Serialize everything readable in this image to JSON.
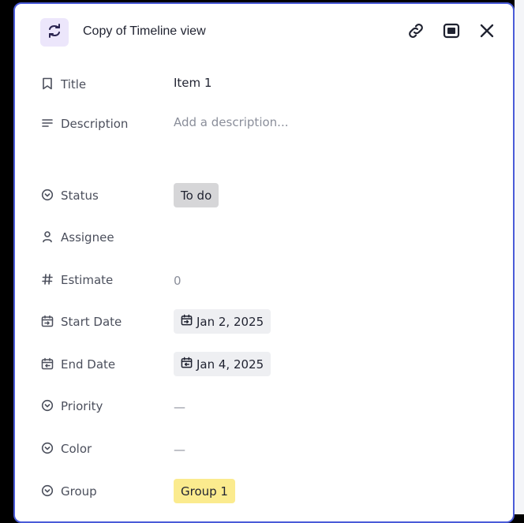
{
  "header": {
    "title": "Copy of Timeline view",
    "icons": {
      "badge": "sync-arrows-icon",
      "link": "link-icon",
      "expand": "expand-panel-icon",
      "close": "close-icon"
    }
  },
  "fields": {
    "title": {
      "label": "Title",
      "value": "Item 1",
      "icon": "bookmark-icon"
    },
    "description": {
      "label": "Description",
      "placeholder": "Add a description...",
      "icon": "lines-icon"
    },
    "status": {
      "label": "Status",
      "value": "To do",
      "icon": "chevron-circle-icon"
    },
    "assignee": {
      "label": "Assignee",
      "value": "",
      "icon": "person-icon"
    },
    "estimate": {
      "label": "Estimate",
      "value": "0",
      "icon": "hash-icon"
    },
    "start_date": {
      "label": "Start Date",
      "value": "Jan 2, 2025",
      "icon": "calendar-start-icon"
    },
    "end_date": {
      "label": "End Date",
      "value": "Jan 4, 2025",
      "icon": "calendar-end-icon"
    },
    "priority": {
      "label": "Priority",
      "value": "—",
      "icon": "chevron-circle-icon"
    },
    "color": {
      "label": "Color",
      "value": "—",
      "icon": "chevron-circle-icon"
    },
    "group": {
      "label": "Group",
      "value": "Group 1",
      "icon": "chevron-circle-icon"
    }
  },
  "colors": {
    "panel_border": "#4a5bd8",
    "badge_bg": "#ece6fb",
    "badge_icon": "#2a2450",
    "status_chip": "#d6d6d8",
    "date_chip": "#eeeff2",
    "group_chip": "#fbeb8e"
  }
}
